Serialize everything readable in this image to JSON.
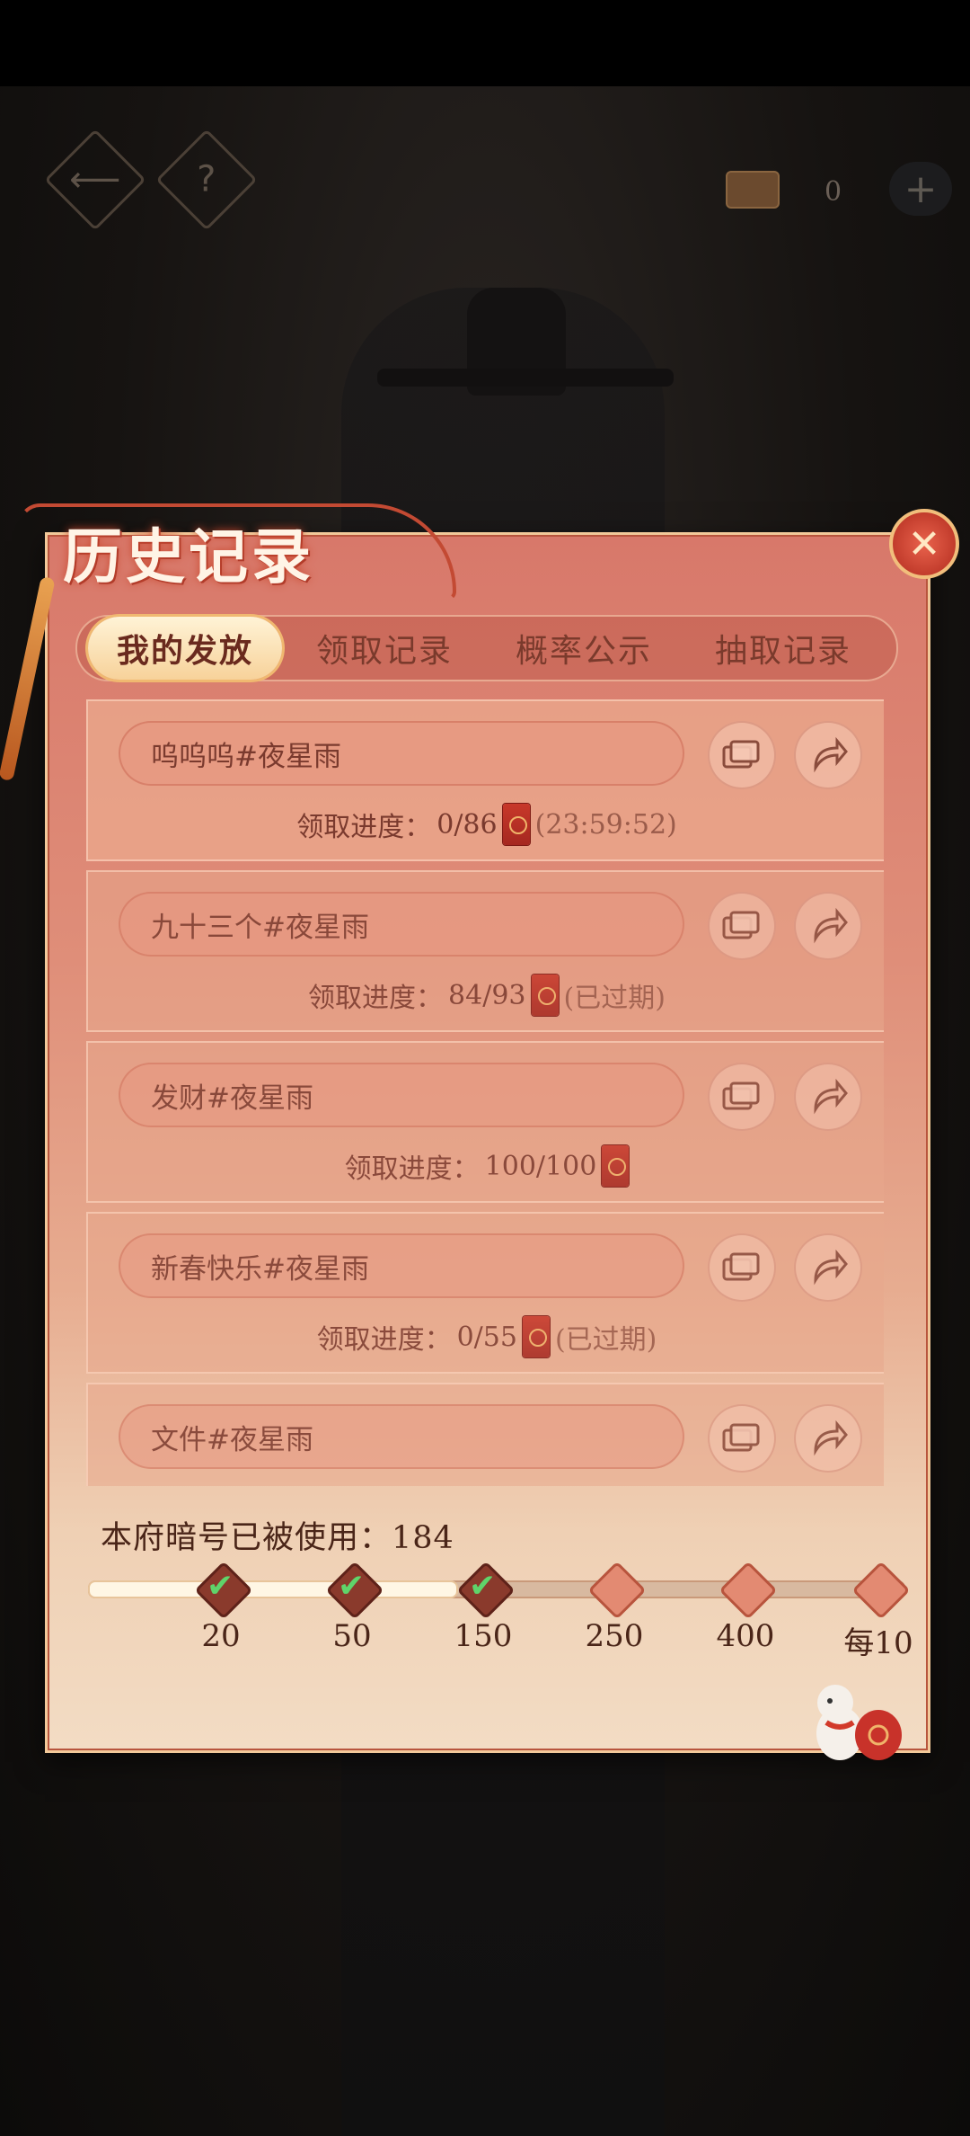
{
  "hud": {
    "back_icon": "back-arrow-icon",
    "help_label": "?",
    "coin_count": "0",
    "plus_label": "+"
  },
  "panel": {
    "title": "历史记录",
    "close_label": "✕"
  },
  "tabs": [
    {
      "label": "我的发放",
      "active": true
    },
    {
      "label": "领取记录",
      "active": false
    },
    {
      "label": "概率公示",
      "active": false
    },
    {
      "label": "抽取记录",
      "active": false
    }
  ],
  "records": [
    {
      "name": "呜呜呜#夜星雨",
      "progress_label": "领取进度：",
      "progress": "0/86",
      "status": "(23:59:52)"
    },
    {
      "name": "九十三个#夜星雨",
      "progress_label": "领取进度：",
      "progress": "84/93",
      "status": "(已过期)"
    },
    {
      "name": "发财#夜星雨",
      "progress_label": "领取进度：",
      "progress": "100/100",
      "status": ""
    },
    {
      "name": "新春快乐#夜星雨",
      "progress_label": "领取进度：",
      "progress": "0/55",
      "status": "(已过期)"
    },
    {
      "name": "文件#夜星雨",
      "progress_label": "",
      "progress": "",
      "status": ""
    }
  ],
  "usage": {
    "label": "本府暗号已被使用：184",
    "value": 184,
    "fill_fraction": 0.45
  },
  "milestones": [
    {
      "label": "20",
      "done": true
    },
    {
      "label": "50",
      "done": true
    },
    {
      "label": "150",
      "done": true
    },
    {
      "label": "250",
      "done": false
    },
    {
      "label": "400",
      "done": false
    },
    {
      "label": "每10",
      "done": false
    }
  ],
  "colors": {
    "accent_red": "#c8382a",
    "panel_top": "#d8786a",
    "panel_bottom": "#f3dcc4",
    "check_green": "#5fd46a"
  }
}
